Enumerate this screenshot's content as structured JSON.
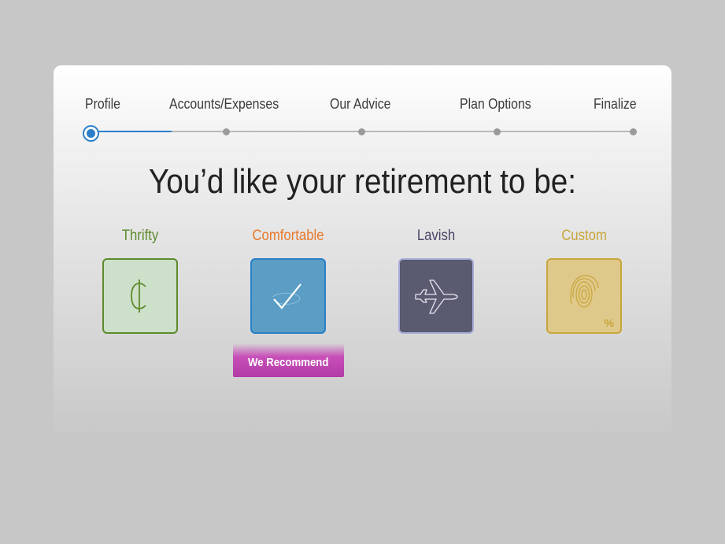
{
  "wizard": {
    "steps": [
      {
        "label": "Profile"
      },
      {
        "label": "Accounts/Expenses"
      },
      {
        "label": "Our Advice"
      },
      {
        "label": "Plan Options"
      },
      {
        "label": "Finalize"
      }
    ],
    "current_step": 1
  },
  "main": {
    "headline": "You’d like your retirement to be:",
    "options": [
      {
        "label": "Thrifty",
        "color": "#5e8a2c",
        "icon": "cent-icon"
      },
      {
        "label": "Comfortable",
        "color": "#e8792a",
        "icon": "checkmark-icon",
        "selected": true
      },
      {
        "label": "Lavish",
        "color": "#4a4466",
        "icon": "airplane-icon"
      },
      {
        "label": "Custom",
        "color": "#c9a53a",
        "icon": "fingerprint-icon",
        "icon_suffix": "%"
      }
    ],
    "recommend_badge": "We Recommend"
  },
  "colors": {
    "accent": "#2a7fc8",
    "recommend": "#b23aa6"
  }
}
